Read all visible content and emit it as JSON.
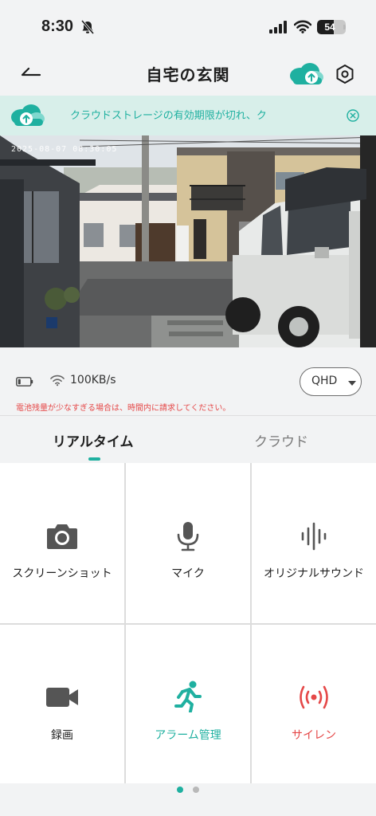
{
  "status_bar": {
    "time": "8:30",
    "battery": "54",
    "battery_level": 0.54
  },
  "header": {
    "title": "自宅の玄関"
  },
  "banner": {
    "text": "クラウドストレージの有効期限が切れ、ク"
  },
  "video": {
    "timestamp": "2025-08-07 08:30:05"
  },
  "info": {
    "net_speed": "100KB/s",
    "quality": "QHD",
    "warning": "電池残量が少なすぎる場合は、時間内に請求してください。"
  },
  "tabs": [
    {
      "label": "リアルタイム",
      "active": true
    },
    {
      "label": "クラウド",
      "active": false
    }
  ],
  "controls": [
    {
      "label": "スクリーンショット",
      "icon": "camera-icon",
      "color": "#555555"
    },
    {
      "label": "マイク",
      "icon": "microphone-icon",
      "color": "#555555"
    },
    {
      "label": "オリジナルサウンド",
      "icon": "sound-wave-icon",
      "color": "#555555"
    },
    {
      "label": "録画",
      "icon": "video-camera-icon",
      "color": "#555555"
    },
    {
      "label": "アラーム管理",
      "icon": "running-person-icon",
      "color": "#1fb0a0"
    },
    {
      "label": "サイレン",
      "icon": "siren-icon",
      "color": "#e54848"
    }
  ],
  "pagination": {
    "total": 2,
    "current": 1
  },
  "colors": {
    "accent": "#1fb0a0",
    "warning": "#e54848",
    "background": "#f2f3f4"
  }
}
